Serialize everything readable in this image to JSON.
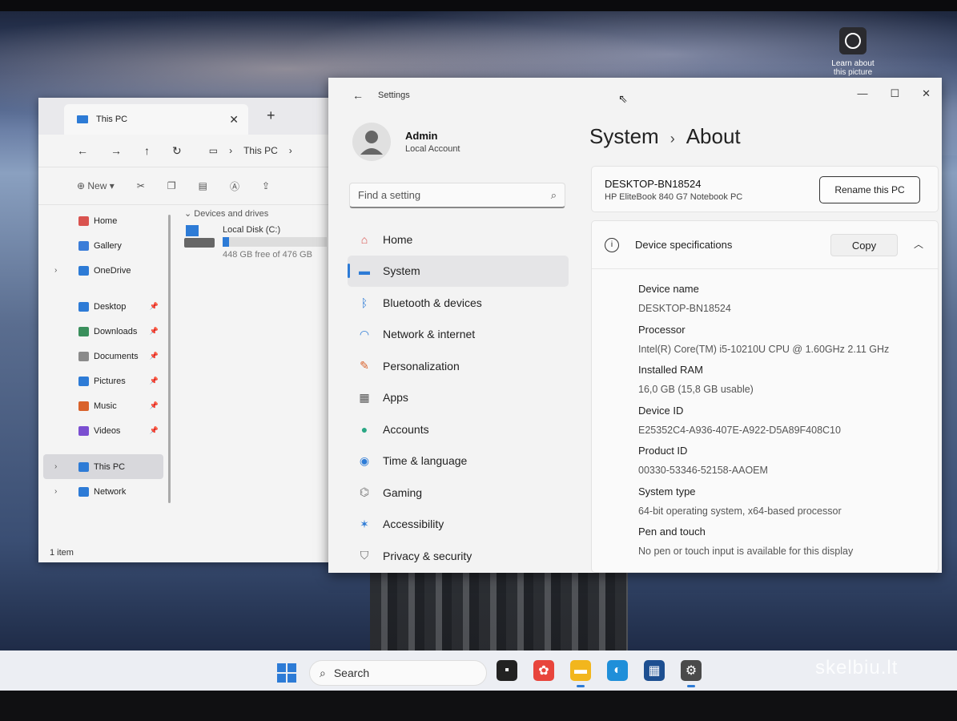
{
  "desktop": {
    "learn_label": "Learn about this picture",
    "watermark": "skelbiu.lt"
  },
  "explorer": {
    "tab_title": "This PC",
    "tab_close": "✕",
    "tab_new": "+",
    "address": [
      "This PC",
      "›"
    ],
    "toolbar_new": "New",
    "sidebar": [
      {
        "label": "Home",
        "color": "#d9534f",
        "pin": false
      },
      {
        "label": "Gallery",
        "color": "#3b7dd8",
        "pin": false
      },
      {
        "label": "OneDrive",
        "color": "#2d7bd6",
        "pin": false,
        "chevron": true
      },
      {
        "label": "Desktop",
        "color": "#2d7bd6",
        "pin": true
      },
      {
        "label": "Downloads",
        "color": "#3a8f5c",
        "pin": true
      },
      {
        "label": "Documents",
        "color": "#8a8a8a",
        "pin": true
      },
      {
        "label": "Pictures",
        "color": "#2d7bd6",
        "pin": true
      },
      {
        "label": "Music",
        "color": "#d9622b",
        "pin": true
      },
      {
        "label": "Videos",
        "color": "#7b4fd1",
        "pin": true
      },
      {
        "label": "This PC",
        "color": "#2d7bd6",
        "pin": false,
        "chevron": true,
        "selected": true
      },
      {
        "label": "Network",
        "color": "#2d7bd6",
        "pin": false,
        "chevron": true
      }
    ],
    "section_header": "Devices and drives",
    "drive_name": "Local Disk (C:)",
    "drive_free": "448 GB free of 476 GB",
    "drive_used_fraction": 0.06,
    "status": "1 item"
  },
  "settings": {
    "title": "Settings",
    "user_name": "Admin",
    "user_type": "Local Account",
    "search_placeholder": "Find a setting",
    "nav": [
      {
        "label": "Home",
        "icon": "home-icon",
        "glyph": "⌂",
        "color": "#d9534f"
      },
      {
        "label": "System",
        "icon": "system-icon",
        "glyph": "▬",
        "color": "#2d7bd6",
        "selected": true
      },
      {
        "label": "Bluetooth & devices",
        "icon": "bluetooth-icon",
        "glyph": "ᛒ",
        "color": "#2d7bd6"
      },
      {
        "label": "Network & internet",
        "icon": "wifi-icon",
        "glyph": "◠",
        "color": "#2d7bd6"
      },
      {
        "label": "Personalization",
        "icon": "brush-icon",
        "glyph": "✎",
        "color": "#d9622b"
      },
      {
        "label": "Apps",
        "icon": "apps-icon",
        "glyph": "▦",
        "color": "#555"
      },
      {
        "label": "Accounts",
        "icon": "accounts-icon",
        "glyph": "●",
        "color": "#2aa784"
      },
      {
        "label": "Time & language",
        "icon": "globe-icon",
        "glyph": "◉",
        "color": "#2d7bd6"
      },
      {
        "label": "Gaming",
        "icon": "gaming-icon",
        "glyph": "⌬",
        "color": "#777"
      },
      {
        "label": "Accessibility",
        "icon": "accessibility-icon",
        "glyph": "✶",
        "color": "#2d7bd6"
      },
      {
        "label": "Privacy & security",
        "icon": "shield-icon",
        "glyph": "⛉",
        "color": "#666"
      }
    ],
    "breadcrumb_parent": "System",
    "breadcrumb_sep": "›",
    "breadcrumb_current": "About",
    "pc_name": "DESKTOP-BN18524",
    "pc_model": "HP EliteBook 840 G7 Notebook PC",
    "rename_label": "Rename this PC",
    "spec_header": "Device specifications",
    "copy_label": "Copy",
    "specs": [
      {
        "label": "Device name",
        "value": "DESKTOP-BN18524"
      },
      {
        "label": "Processor",
        "value": "Intel(R) Core(TM) i5-10210U CPU @ 1.60GHz   2.11 GHz"
      },
      {
        "label": "Installed RAM",
        "value": "16,0 GB (15,8 GB usable)"
      },
      {
        "label": "Device ID",
        "value": "E25352C4-A936-407E-A922-D5A89F408C10"
      },
      {
        "label": "Product ID",
        "value": "00330-53346-52158-AAOEM"
      },
      {
        "label": "System type",
        "value": "64-bit operating system, x64-based processor"
      },
      {
        "label": "Pen and touch",
        "value": "No pen or touch input is available for this display"
      }
    ]
  },
  "taskbar": {
    "search_label": "Search"
  }
}
